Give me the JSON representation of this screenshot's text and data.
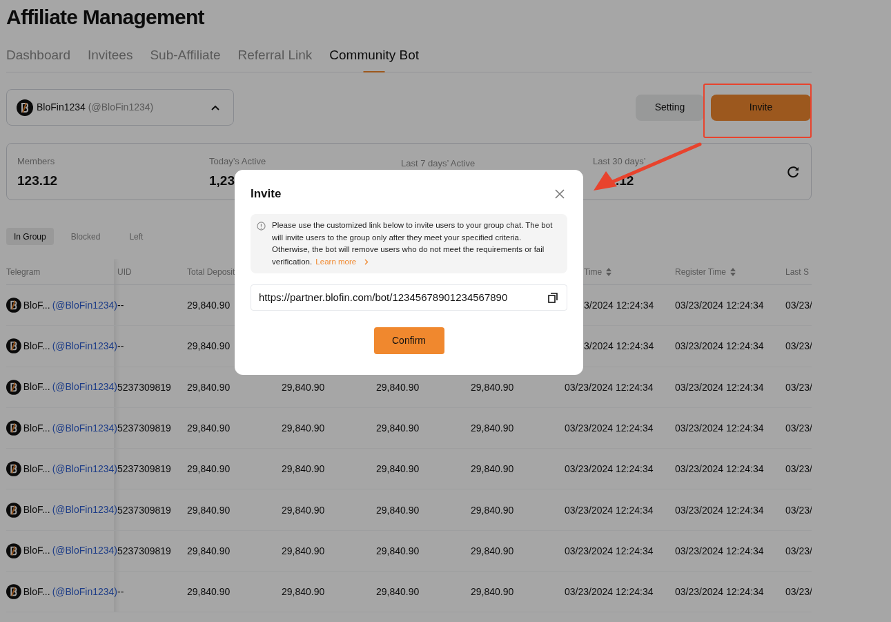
{
  "page_title": "Affiliate Management",
  "tabs": [
    {
      "label": "Dashboard",
      "selected": false
    },
    {
      "label": "Invitees",
      "selected": false
    },
    {
      "label": "Sub-Affiliate",
      "selected": false
    },
    {
      "label": "Referral Link",
      "selected": false
    },
    {
      "label": "Community Bot",
      "selected": true
    }
  ],
  "bot_selector": {
    "name": "BloFin1234",
    "handle": "(@BloFin1234)",
    "expanded": true
  },
  "actions": [
    {
      "label": "Setting",
      "kind": "secondary"
    },
    {
      "label": "Invite",
      "kind": "primary",
      "highlighted": true
    }
  ],
  "stats": [
    {
      "label": "Members",
      "value": "123.12"
    },
    {
      "label": "Today’s Active",
      "value": "1,23"
    },
    {
      "label": "Last 7 days’ Active"
    },
    {
      "label": "Last 30 days’",
      "value": ".12",
      "covered": true
    }
  ],
  "filter_tabs": [
    {
      "label": "In Group",
      "selected": true
    },
    {
      "label": "Blocked",
      "selected": false
    },
    {
      "label": "Left",
      "selected": false
    }
  ],
  "table": {
    "columns": [
      {
        "label": "Telegram"
      },
      {
        "label": "UID"
      },
      {
        "label": "Total Deposit"
      },
      null,
      null,
      null,
      {
        "label": "Time",
        "sortable": true,
        "covered": true
      },
      {
        "label": "Register Time",
        "sortable": true
      },
      {
        "label": "Last S"
      }
    ],
    "rows": [
      {
        "cells": [
          {
            "name": "BloF...",
            "handle": "(@BloFin1234)"
          },
          "--",
          "29,840.90",
          null,
          null,
          null,
          "3/2024 12:24:34",
          "03/23/2024 12:24:34",
          "03/23/"
        ]
      },
      {
        "cells": [
          {
            "name": "BloF...",
            "handle": "(@BloFin1234)"
          },
          "--",
          "29,840.90",
          null,
          null,
          null,
          "3/2024 12:24:34",
          "03/23/2024 12:24:34",
          "03/23/"
        ]
      },
      {
        "cells": [
          {
            "name": "BloF...",
            "handle": "(@BloFin1234)"
          },
          "5237309819",
          "29,840.90",
          "29,840.90",
          "29,840.90",
          "29,840.90",
          "03/23/2024 12:24:34",
          "03/23/2024 12:24:34",
          "03/23/"
        ]
      },
      {
        "cells": [
          {
            "name": "BloF...",
            "handle": "(@BloFin1234)"
          },
          "5237309819",
          "29,840.90",
          "29,840.90",
          "29,840.90",
          "29,840.90",
          "03/23/2024 12:24:34",
          "03/23/2024 12:24:34",
          "03/23/"
        ]
      },
      {
        "cells": [
          {
            "name": "BloF...",
            "handle": "(@BloFin1234)"
          },
          "5237309819",
          "29,840.90",
          "29,840.90",
          "29,840.90",
          "29,840.90",
          "03/23/2024 12:24:34",
          "03/23/2024 12:24:34",
          "03/23/"
        ]
      },
      {
        "cells": [
          {
            "name": "BloF...",
            "handle": "(@BloFin1234)"
          },
          "5237309819",
          "29,840.90",
          "29,840.90",
          "29,840.90",
          "29,840.90",
          "03/23/2024 12:24:34",
          "03/23/2024 12:24:34",
          "03/23/"
        ]
      },
      {
        "cells": [
          {
            "name": "BloF...",
            "handle": "(@BloFin1234)"
          },
          "5237309819",
          "29,840.90",
          "29,840.90",
          "29,840.90",
          "29,840.90",
          "03/23/2024 12:24:34",
          "03/23/2024 12:24:34",
          "03/23/"
        ]
      },
      {
        "cells": [
          {
            "name": "BloF...",
            "handle": "(@BloFin1234)"
          },
          "--",
          "29,840.90",
          "29,840.90",
          "29,840.90",
          "29,840.90",
          "03/23/2024 12:24:34",
          "03/23/2024 12:24:34",
          "03/23/"
        ]
      }
    ]
  },
  "dialog": {
    "title": "Invite",
    "notice": "Please use the customized link below to invite users to your group chat. The bot will invite users to the group only after they meet your specified criteria. Otherwise, the bot will remove users who do not meet the requirements or fail verification.",
    "learn_more": "Learn more",
    "link": "https://partner.blofin.com/bot/12345678901234567890",
    "confirm": "Confirm"
  }
}
